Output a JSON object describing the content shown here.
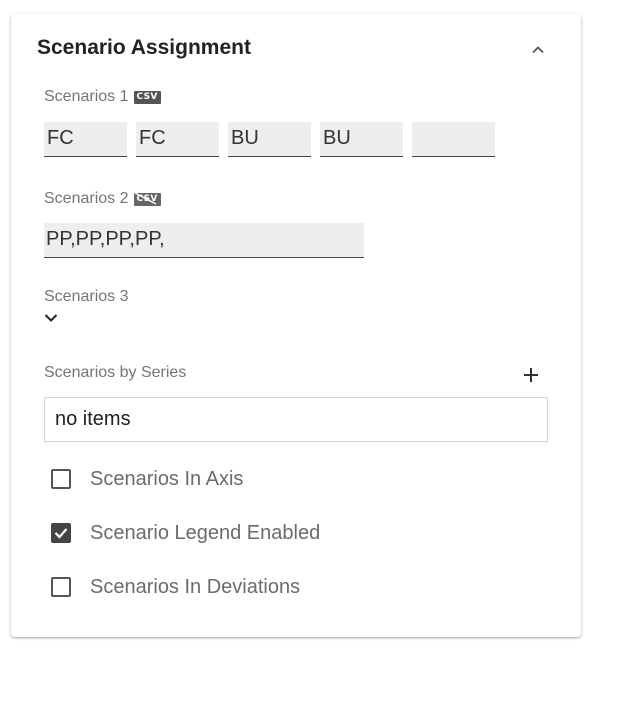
{
  "panel": {
    "title": "Scenario Assignment",
    "collapse_icon": "chevron-up-icon"
  },
  "scenarios1": {
    "label": "Scenarios 1",
    "badge": "CSV",
    "badge_state": "enabled",
    "fields": [
      "FC",
      "FC",
      "BU",
      "BU",
      ""
    ]
  },
  "scenarios2": {
    "label": "Scenarios 2",
    "badge": "CSV",
    "badge_state": "disabled",
    "value": "PP,PP,PP,PP,"
  },
  "scenarios3": {
    "label": "Scenarios 3",
    "dropdown_icon": "chevron-down-icon"
  },
  "series": {
    "label": "Scenarios by Series",
    "add_icon": "plus-icon",
    "empty_text": "no items"
  },
  "options": [
    {
      "label": "Scenarios In Axis",
      "checked": false
    },
    {
      "label": "Scenario Legend Enabled",
      "checked": true
    },
    {
      "label": "Scenarios In Deviations",
      "checked": false
    }
  ]
}
